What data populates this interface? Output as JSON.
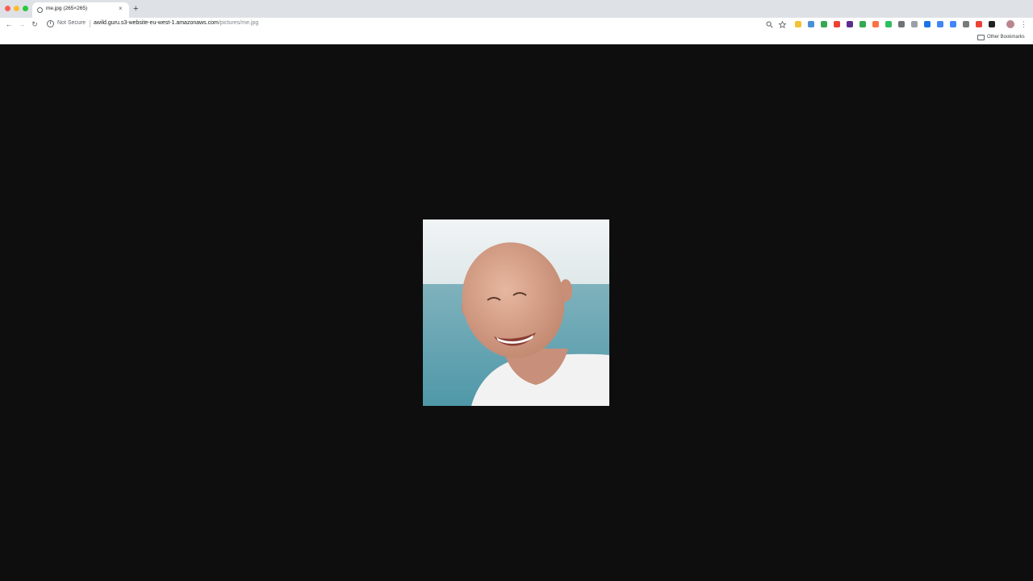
{
  "window": {
    "traffic_lights": [
      "close",
      "minimize",
      "maximize"
    ]
  },
  "tab": {
    "title": "me.jpg (265×265)",
    "close_label": "×",
    "favicon": "globe-icon"
  },
  "new_tab_label": "+",
  "toolbar": {
    "back_icon": "←",
    "forward_icon": "→",
    "reload_icon": "↻",
    "security_label": "Not Secure",
    "url_host": "awild.guru.s3-website-eu-west-1.amazonaws.com",
    "url_path": "/pictures/me.jpg",
    "extensions": [
      {
        "name": "zoom-icon"
      },
      {
        "name": "bookmark-star-icon"
      },
      {
        "name": "extension-bolt-icon",
        "color": "#f1c232"
      },
      {
        "name": "extension-phone-icon",
        "color": "#4a90d9"
      },
      {
        "name": "extension-drive-icon",
        "color": "#34a853"
      },
      {
        "name": "extension-mail-icon",
        "color": "#ea4335"
      },
      {
        "name": "extension-badge-icon",
        "color": "#5c2d91"
      },
      {
        "name": "extension-check-icon",
        "color": "#34a853"
      },
      {
        "name": "extension-orange-icon",
        "color": "#ff7043"
      },
      {
        "name": "extension-evernote-icon",
        "color": "#2dbe60"
      },
      {
        "name": "extension-circle-icon",
        "color": "#6e7378"
      },
      {
        "name": "extension-box-icon",
        "color": "#9aa0a6"
      },
      {
        "name": "extension-blue-icon",
        "color": "#1a73e8"
      },
      {
        "name": "extension-w-icon",
        "color": "#4285f4"
      },
      {
        "name": "extension-grid-icon",
        "color": "#4285f4"
      },
      {
        "name": "extension-camera-icon",
        "color": "#7a7a7a"
      },
      {
        "name": "extension-red-icon",
        "color": "#ea4335"
      },
      {
        "name": "extension-dark-icon",
        "color": "#202124"
      }
    ],
    "menu_icon": "⋮"
  },
  "bookmarks": {
    "other_label": "Other Bookmarks"
  },
  "content": {
    "background": "#0e0e0e",
    "image_alt": "me.jpg"
  }
}
